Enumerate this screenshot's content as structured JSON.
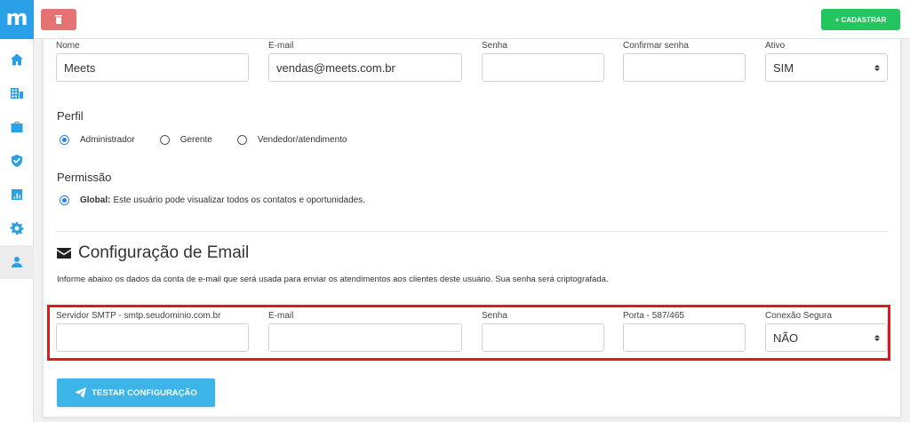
{
  "sidebar": {
    "logo": "m",
    "items": [
      {
        "icon": "home-icon"
      },
      {
        "icon": "building-icon"
      },
      {
        "icon": "briefcase-icon"
      },
      {
        "icon": "shield-check-icon"
      },
      {
        "icon": "bar-chart-icon"
      },
      {
        "icon": "gear-icon"
      },
      {
        "icon": "user-icon"
      }
    ],
    "accent": "#2b9fe6"
  },
  "toolbar": {
    "delete_icon": "trash-icon",
    "cadastrar_label": "+ CADASTRAR"
  },
  "user_form": {
    "nome": {
      "label": "Nome",
      "value": "Meets"
    },
    "email": {
      "label": "E-mail",
      "value": "vendas@meets.com.br"
    },
    "senha": {
      "label": "Senha",
      "value": ""
    },
    "confirmar": {
      "label": "Confirmar senha",
      "value": ""
    },
    "ativo": {
      "label": "Ativo",
      "value": "SIM"
    }
  },
  "perfil": {
    "title": "Perfil",
    "options": [
      {
        "label": "Administrador",
        "checked": true
      },
      {
        "label": "Gerente",
        "checked": false
      },
      {
        "label": "Vendedor/atendimento",
        "checked": false
      }
    ]
  },
  "permissao": {
    "title": "Permissão",
    "bold": "Global:",
    "text": "Este usuário pode visualizar todos os contatos e oportunidades."
  },
  "email_config": {
    "title": "Configuração de Email",
    "description": "Informe abaixo os dados da conta de e-mail que será usada para enviar os atendimentos aos clientes deste usuário. Sua senha será criptografada.",
    "smtp": {
      "label": "Servidor SMTP - smtp.seudominio.com.br",
      "value": ""
    },
    "email": {
      "label": "E-mail",
      "value": ""
    },
    "senha": {
      "label": "Senha",
      "value": ""
    },
    "porta": {
      "label": "Porta - 587/465",
      "value": ""
    },
    "conexao": {
      "label": "Conexão Segura",
      "value": "NÃO"
    },
    "highlight_color": "#e01a1a"
  },
  "test_button": {
    "label": "TESTAR CONFIGURAÇÃO",
    "icon": "paper-plane-icon"
  }
}
